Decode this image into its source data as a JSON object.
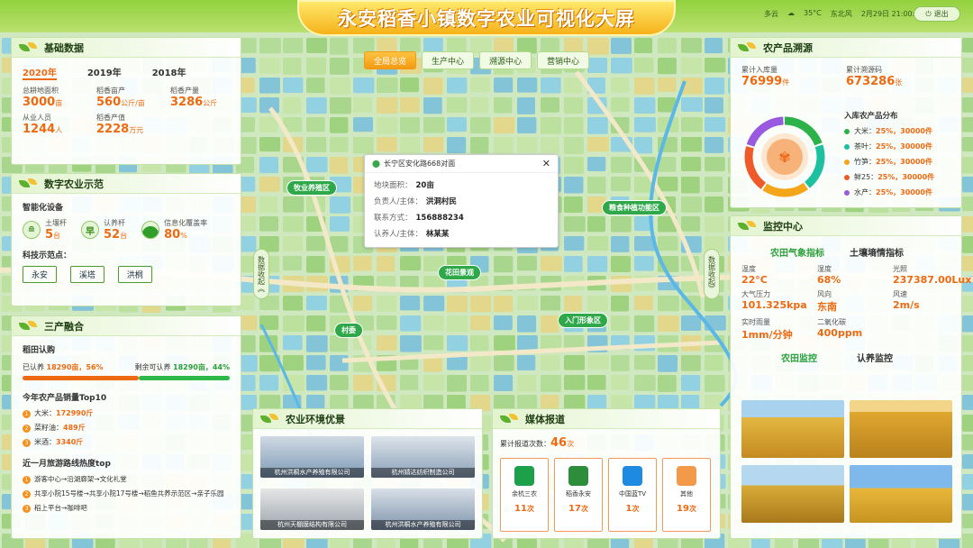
{
  "header": {
    "title": "永安稻香小镇数字农业可视化大屏",
    "weather": "多云",
    "temperature": "35°C",
    "wind": "东北风",
    "datetime": "2月29日 21:00:01",
    "exit_label": "退出"
  },
  "nav_tabs": [
    "全局总览",
    "生产中心",
    "溯源中心",
    "营销中心"
  ],
  "basic_data": {
    "title": "基础数据",
    "years": [
      "2020年",
      "2019年",
      "2018年"
    ],
    "stats": [
      {
        "label": "总耕地面积",
        "value": "3000",
        "unit": "亩"
      },
      {
        "label": "稻香亩产",
        "value": "560",
        "unit": "公斤/亩"
      },
      {
        "label": "稻香产量",
        "value": "3286",
        "unit": "公斤"
      },
      {
        "label": "从业人员",
        "value": "1244",
        "unit": "人"
      },
      {
        "label": "稻香产值",
        "value": "2228",
        "unit": "万元"
      }
    ]
  },
  "digital_agri": {
    "title": "数字农业示范",
    "subtitle": "智能化设备",
    "devices": [
      {
        "icon": "soil-rod-icon",
        "label": "土壤杆",
        "value": "5",
        "unit": "台"
      },
      {
        "icon": "raise-rod-icon",
        "label": "认养杆",
        "value": "52",
        "unit": "台"
      },
      {
        "icon": "coverage-icon",
        "label": "信息化覆盖率",
        "value": "80",
        "unit": "%"
      }
    ],
    "demo_label": "科技示范点：",
    "demo_points": [
      "永安",
      "溪塔",
      "洪桐"
    ]
  },
  "three_industry": {
    "title": "三产融合",
    "adopt_title": "稻田认购",
    "adopted_label": "已认养",
    "adopted_value": "18290亩，56%",
    "adopted_pct": 56,
    "remaining_label": "剩余可认养",
    "remaining_value": "18290亩，44%",
    "top10_title": "今年农产品销量Top10",
    "top10": [
      {
        "rank": "1",
        "name": "大米：",
        "value": "172990斤"
      },
      {
        "rank": "2",
        "name": "菜籽油：",
        "value": "489斤"
      },
      {
        "rank": "3",
        "name": "米酒：",
        "value": "3340斤"
      }
    ],
    "routes_title": "近一月旅游路线热度top",
    "routes": [
      {
        "rank": "1",
        "text": "游客中心→沿湖廊架→文化礼堂"
      },
      {
        "rank": "2",
        "text": "共享小院15号楼→共享小院17号楼→稻鱼共养示范区→亲子乐园"
      },
      {
        "rank": "3",
        "text": "稻上平台→咖啡吧"
      }
    ]
  },
  "map": {
    "labels": [
      "牧业养殖区",
      "粮食种植功能区",
      "花田景观",
      "入门形象区",
      "村委"
    ],
    "side_left": "数据收起《",
    "side_right": "数据收起》",
    "popup": {
      "address": "长宁区安化路668对面",
      "rows": [
        {
          "label": "地块面积：",
          "value": "20亩"
        },
        {
          "label": "负责人/主体：",
          "value": "洪洞村民"
        },
        {
          "label": "联系方式：",
          "value": "156888234"
        },
        {
          "label": "认养人/主体：",
          "value": "林某某"
        }
      ]
    }
  },
  "environment": {
    "title": "农业环境优景",
    "photos": [
      "杭州洪桐水产养殖有限公司",
      "杭州婧达纺织制造公司",
      "杭州天棚膜结构有限公司",
      "杭州洪桐水产养殖有限公司"
    ]
  },
  "media": {
    "title": "媒体报道",
    "total_label": "累计报道次数：",
    "total_value": "46",
    "total_unit": "次",
    "items": [
      {
        "name": "余杭三农",
        "count": "11",
        "unit": "次",
        "color": "#1ca14a"
      },
      {
        "name": "稻香永安",
        "count": "17",
        "unit": "次",
        "color": "#2c8e3a"
      },
      {
        "name": "中国蓝TV",
        "count": "1",
        "unit": "次",
        "color": "#1e8be0"
      },
      {
        "name": "其他",
        "count": "19",
        "unit": "次",
        "color": "#f39a4a"
      }
    ]
  },
  "trace": {
    "title": "农产品溯源",
    "in_label": "累计入库量",
    "in_value": "76999",
    "in_unit": "件",
    "code_label": "累计溯源码",
    "code_value": "673286",
    "code_unit": "张",
    "dist_title": "入库农产品分布",
    "dist": [
      {
        "name": "大米：",
        "value": "25%，30000件",
        "color": "#2db24a"
      },
      {
        "name": "茶叶：",
        "value": "25%，30000件",
        "color": "#1ec0a0"
      },
      {
        "name": "竹笋：",
        "value": "25%，30000件",
        "color": "#f3a61a"
      },
      {
        "name": "鲜25：",
        "value": "25%，30000件",
        "color": "#ee5a2a"
      },
      {
        "name": "水产：",
        "value": "25%，30000件",
        "color": "#9a5ae0"
      }
    ]
  },
  "monitor": {
    "title": "监控中心",
    "tabs": [
      "农田气象指标",
      "土壤墒情指标"
    ],
    "metrics": [
      {
        "label": "温度",
        "value": "22°C"
      },
      {
        "label": "湿度",
        "value": "68%"
      },
      {
        "label": "光照",
        "value": "237387.00Lux"
      },
      {
        "label": "大气压力",
        "value": "101.325kpa"
      },
      {
        "label": "风向",
        "value": "东南"
      },
      {
        "label": "风速",
        "value": "2m/s"
      },
      {
        "label": "实时雨量",
        "value": "1mm/分钟"
      },
      {
        "label": "二氧化碳",
        "value": "400ppm"
      }
    ],
    "video_tabs": [
      "农田监控",
      "认养监控"
    ]
  }
}
